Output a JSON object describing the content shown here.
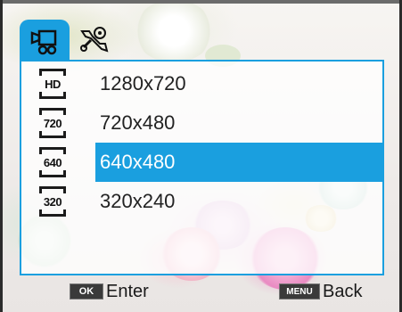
{
  "tabs": [
    {
      "icon": "movie-camera-icon",
      "active": true
    },
    {
      "icon": "settings-wrench-icon",
      "active": false
    }
  ],
  "resolutions": [
    {
      "badge": "HD",
      "label": "1280x720",
      "selected": false
    },
    {
      "badge": "720",
      "label": "720x480",
      "selected": false
    },
    {
      "badge": "640",
      "label": "640x480",
      "selected": true
    },
    {
      "badge": "320",
      "label": "320x240",
      "selected": false
    }
  ],
  "footer": {
    "ok_key": "OK",
    "ok_action": "Enter",
    "menu_key": "MENU",
    "menu_action": "Back"
  },
  "colors": {
    "accent": "#1a9fdf"
  }
}
